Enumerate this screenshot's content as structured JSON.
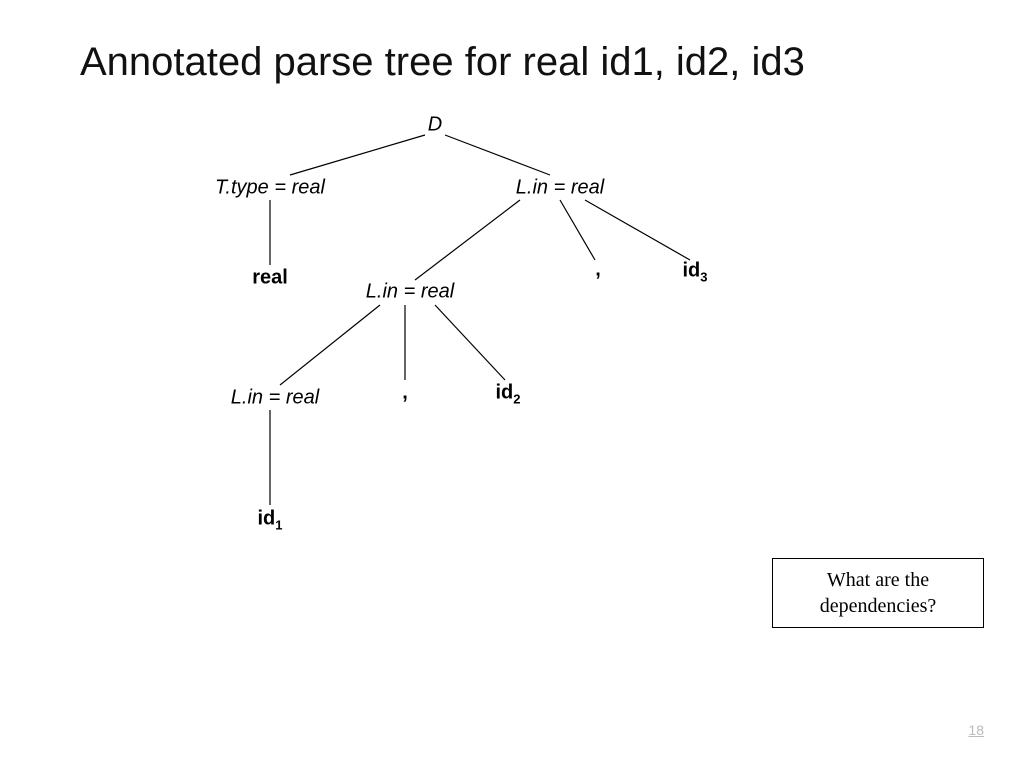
{
  "title": "Annotated parse tree for real id1, id2, id3",
  "page_number": "18",
  "question": "What are the dependencies?",
  "nodes": {
    "D": "D",
    "T": "T.type = real",
    "L1": "L.in = real",
    "real": "real",
    "L2": "L.in = real",
    "comma1": ",",
    "id3": "id",
    "id3s": "3",
    "L3": "L.in = real",
    "comma2": ",",
    "id2": "id",
    "id2s": "2",
    "id1": "id",
    "id1s": "1"
  }
}
